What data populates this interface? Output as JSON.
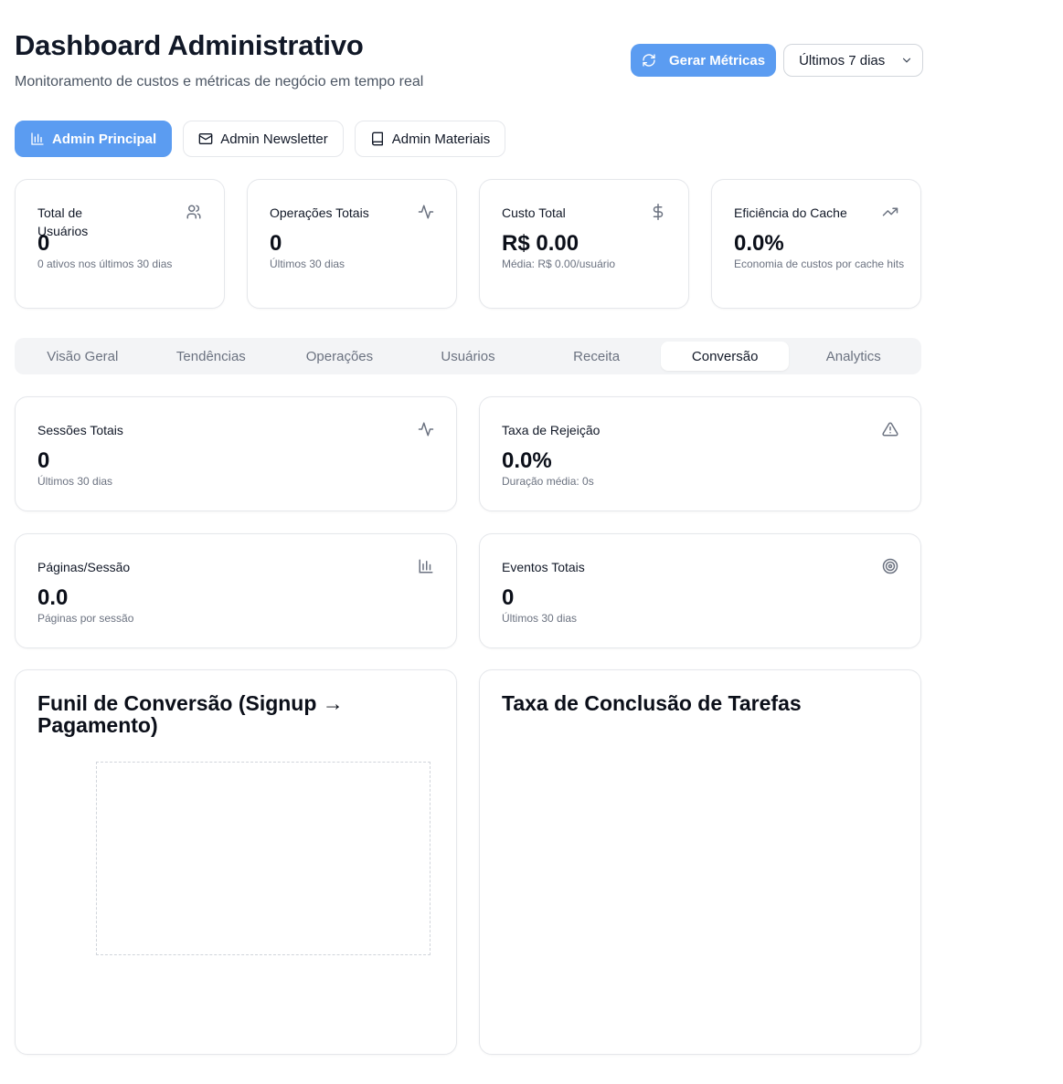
{
  "header": {
    "title": "Dashboard Administrativo",
    "subtitle": "Monitoramento de custos e métricas de negócio em tempo real",
    "generate_button": "Gerar Métricas",
    "period_select": "Últimos 7 dias"
  },
  "nav": {
    "admin_principal": "Admin Principal",
    "admin_newsletter": "Admin Newsletter",
    "admin_materiais": "Admin Materiais"
  },
  "stats": [
    {
      "label": "Total de Usuários",
      "value": "0",
      "sub": "0 ativos nos últimos 30 dias",
      "icon": "users-icon"
    },
    {
      "label": "Operações Totais",
      "value": "0",
      "sub": "Últimos 30 dias",
      "icon": "activity-icon"
    },
    {
      "label": "Custo Total",
      "value": "R$ 0.00",
      "sub": "Média: R$ 0.00/usuário",
      "icon": "dollar-icon"
    },
    {
      "label": "Eficiência do Cache",
      "value": "0.0%",
      "sub": "Economia de custos por cache hits",
      "icon": "trending-up-icon"
    }
  ],
  "tabs": [
    "Visão Geral",
    "Tendências",
    "Operações",
    "Usuários",
    "Receita",
    "Conversão",
    "Analytics"
  ],
  "active_tab": "Conversão",
  "conversion": [
    {
      "label": "Sessões Totais",
      "value": "0",
      "sub": "Últimos 30 dias",
      "icon": "activity-icon"
    },
    {
      "label": "Taxa de Rejeição",
      "value": "0.0%",
      "sub": "Duração média: 0s",
      "icon": "alert-triangle-icon"
    },
    {
      "label": "Páginas/Sessão",
      "value": "0.0",
      "sub": "Páginas por sessão",
      "icon": "bar-chart-icon"
    },
    {
      "label": "Eventos Totais",
      "value": "0",
      "sub": "Últimos 30 dias",
      "icon": "target-icon"
    }
  ],
  "charts": {
    "funnel_title": "Funil de Conversão (Signup → Pagamento)",
    "tasks_title": "Taxa de Conclusão de Tarefas"
  },
  "colors": {
    "primary": "#5b9cf1",
    "border": "#e5e7eb",
    "muted": "#6b7280"
  }
}
